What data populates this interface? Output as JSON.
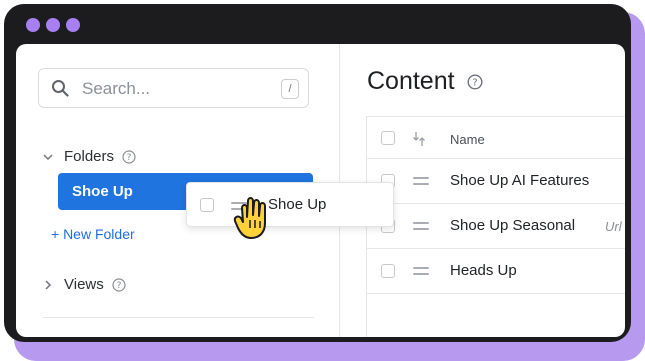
{
  "window": {
    "accent": "#a77ff0"
  },
  "sidebar": {
    "search": {
      "placeholder": "Search...",
      "shortcut": "/"
    },
    "folders": {
      "label": "Folders",
      "active_folder": "Shoe Up",
      "new_folder": "+ New Folder"
    },
    "views": {
      "label": "Views"
    }
  },
  "main": {
    "title": "Content",
    "table": {
      "header": {
        "name": "Name"
      },
      "rows": [
        {
          "name": "Shoe Up AI Features",
          "tag": ""
        },
        {
          "name": "Shoe Up Seasonal",
          "tag": "Url"
        },
        {
          "name": "Heads Up",
          "tag": ""
        }
      ]
    }
  },
  "drag": {
    "label": "Shoe Up",
    "cursor_icon": "grab-hand-cursor"
  },
  "colors": {
    "active_folder_bg": "#1f74e0",
    "link": "#1f6fe0",
    "frame_shadow": "#b79af0"
  }
}
